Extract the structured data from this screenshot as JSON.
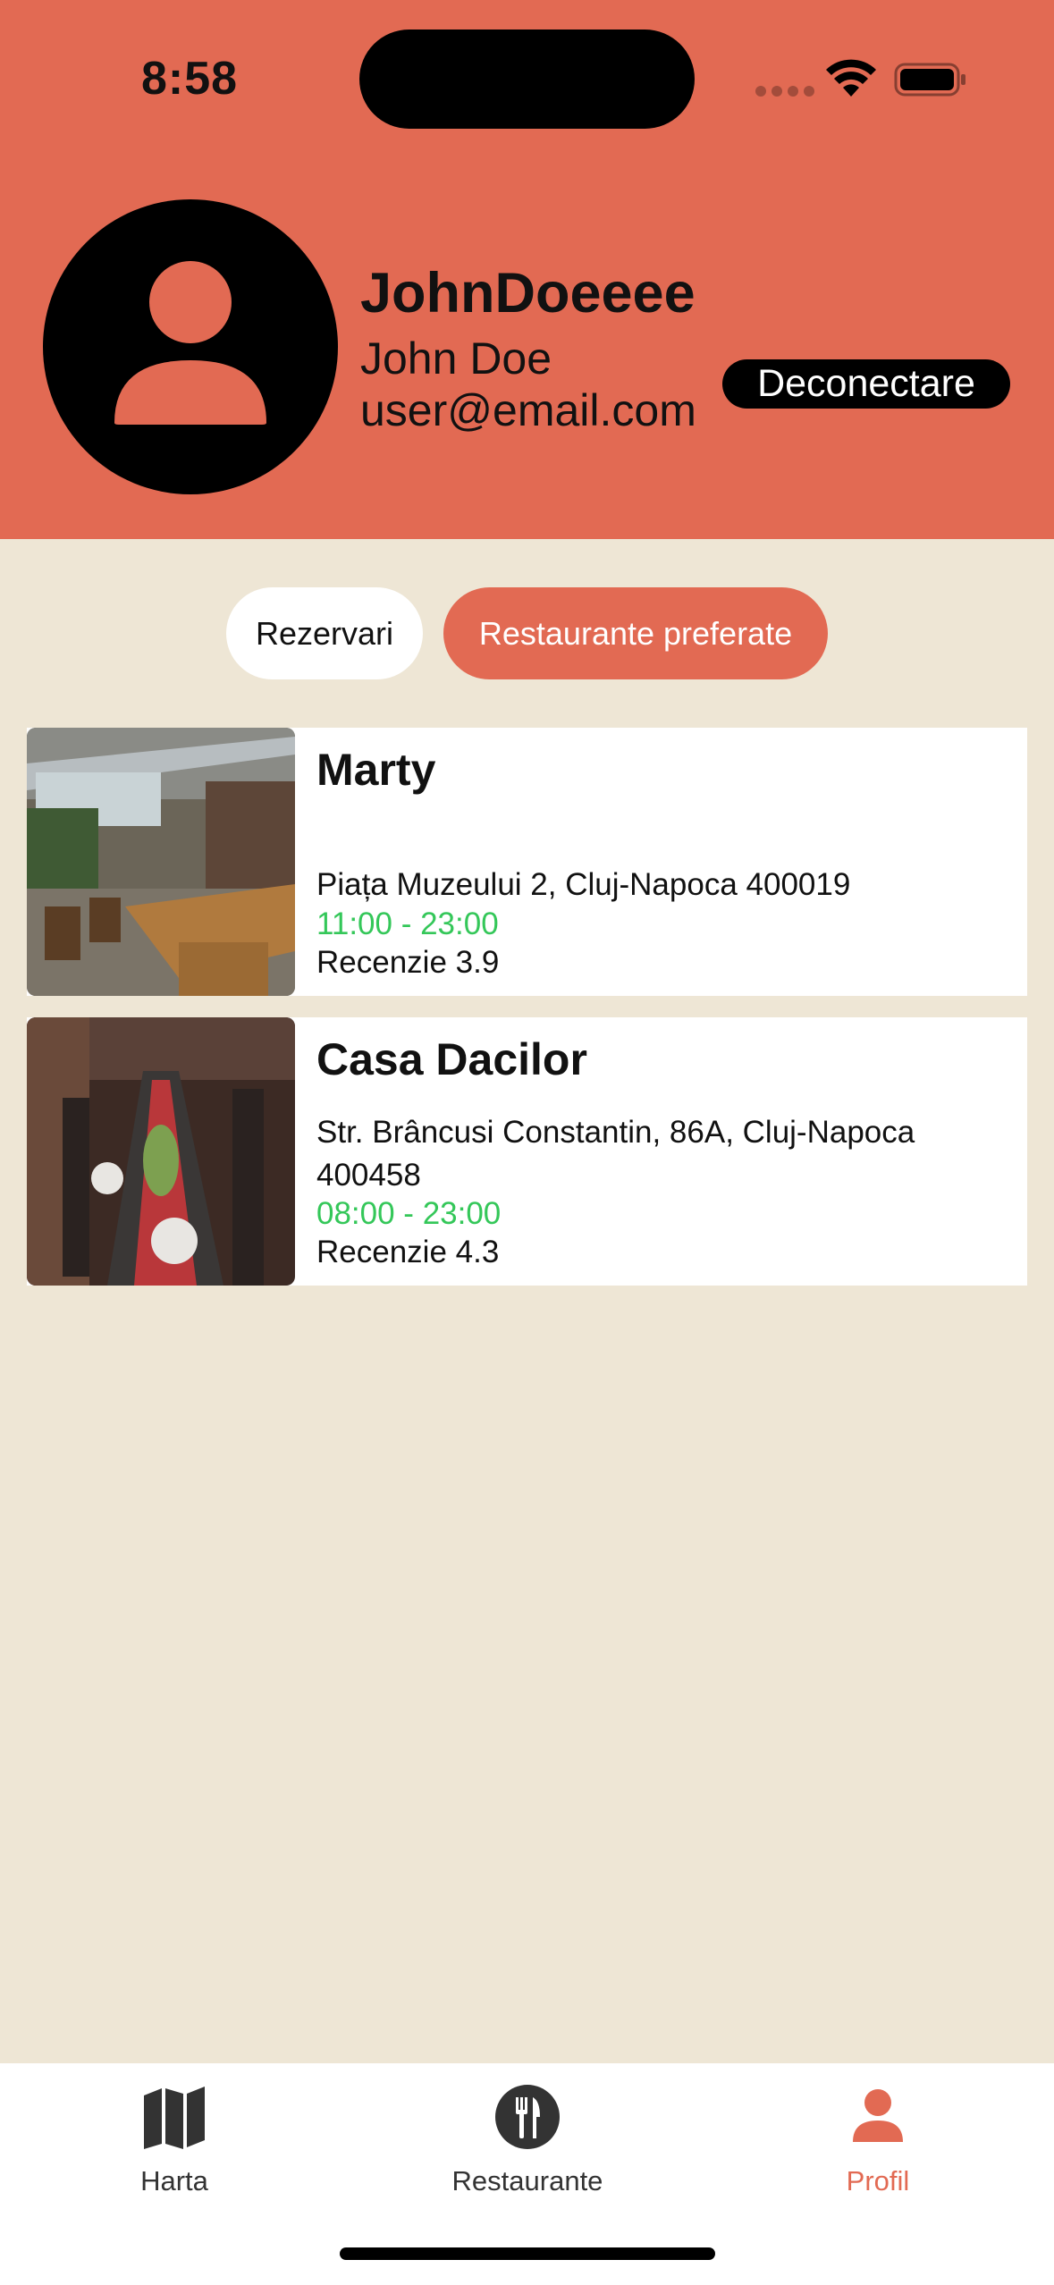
{
  "status_bar": {
    "time": "8:58"
  },
  "profile": {
    "username": "JohnDoeeee",
    "full_name": "John Doe",
    "email": "user@email.com",
    "logout_label": "Deconectare"
  },
  "tabs": [
    {
      "label": "Rezervari",
      "selected": false
    },
    {
      "label": "Restaurante preferate",
      "selected": true
    }
  ],
  "restaurants": [
    {
      "name": "Marty",
      "address": "Piața Muzeului 2, Cluj-Napoca 400019",
      "hours": "11:00 - 23:00",
      "review": "Recenzie 3.9"
    },
    {
      "name": "Casa Dacilor",
      "address": "Str. Brâncusi Constantin, 86A, Cluj-Napoca 400458",
      "hours": "08:00 - 23:00",
      "review": "Recenzie 4.3"
    }
  ],
  "tab_bar": [
    {
      "label": "Harta",
      "icon": "map-icon",
      "active": false
    },
    {
      "label": "Restaurante",
      "icon": "fork-knife-icon",
      "active": false
    },
    {
      "label": "Profil",
      "icon": "person-icon",
      "active": true
    }
  ],
  "colors": {
    "accent": "#E26A53",
    "background": "#EEE6D5",
    "open_hours": "#34C759"
  }
}
